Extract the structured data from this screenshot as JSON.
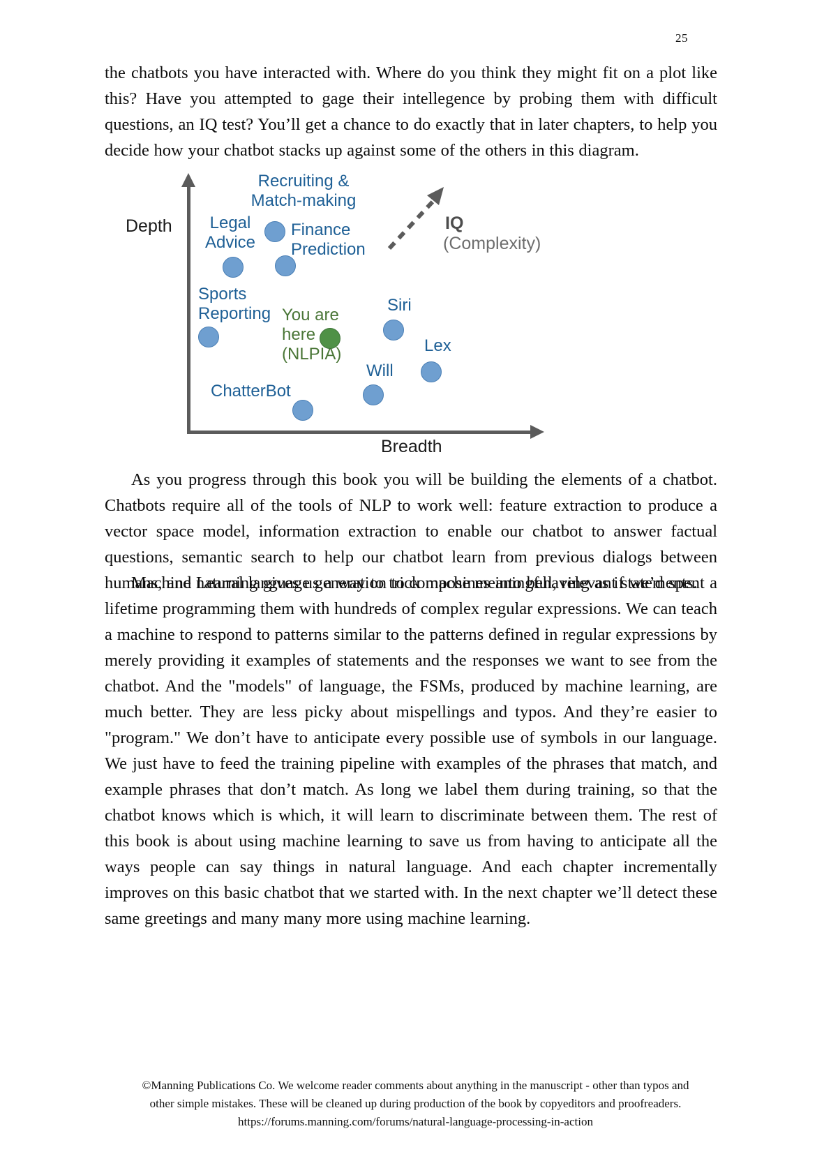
{
  "page": {
    "number": "25"
  },
  "paragraphs": {
    "p1": "the chatbots you have interacted with. Where do you think they might fit on a plot like this? Have you attempted to gage their intellegence by probing them with difficult questions, an IQ test? You’ll get a chance to do exactly that in later chapters, to help you decide how your chatbot stacks up against some of the others in this diagram.",
    "p2": "As you progress through this book you will be building the elements of a chatbot. Chatbots require all of the tools of NLP to work well: feature extraction to produce a vector space model, information extraction to enable our chatbot to answer factual questions, semantic search to help our chatbot learn from previous dialogs between humans, and natural language generation to compose meaningful, relevant statements.",
    "p3": "Machine Learning gives us a way to trick machines into behaving as if we’d spent a lifetime programming them with hundreds of complex regular expressions. We can teach a machine to respond to patterns similar to the patterns defined in regular expressions by merely providing it examples of statements and the responses we want to see from the chatbot. And the \"models\" of language, the FSMs, produced by machine learning, are much better. They are less picky about mispellings and typos. And they’re easier to \"program.\" We don’t have to anticipate every possible use of symbols in our language. We just have to feed the training pipeline with examples of the phrases that match, and example phrases that don’t match. As long we label them during training, so that the chatbot knows which is which, it will learn to discriminate between them. The rest of this book is about using machine learning to save us from having to anticipate all the ways people can say things in natural language. And each chapter incrementally improves on this basic chatbot that we started with. In the next chapter we’ll detect these same greetings and many many more using machine learning."
  },
  "figure": {
    "y_axis_label": "Depth",
    "x_axis_label": "Breadth",
    "annotation": {
      "main": "IQ",
      "sub": "(Complexity)"
    },
    "colors": {
      "dot_blue": "#6f9fd0",
      "dot_green": "#4f9146",
      "label_blue": "#1f6096",
      "label_green": "#4a7637",
      "axis_gray": "#5b5b5b",
      "annotation_gray": "#5b5b5b"
    },
    "points": [
      {
        "label": "Recruiting &\nMatch-making",
        "color": "blue"
      },
      {
        "label": "Legal\nAdvice",
        "color": "blue"
      },
      {
        "label": "Finance\nPrediction",
        "color": "blue"
      },
      {
        "label": "Sports\nReporting",
        "color": "blue"
      },
      {
        "label": "You are\nhere\n(NLPIA)",
        "color": "green"
      },
      {
        "label": "Siri",
        "color": "blue"
      },
      {
        "label": "Lex",
        "color": "blue"
      },
      {
        "label": "Will",
        "color": "blue"
      },
      {
        "label": "ChatterBot",
        "color": "blue"
      }
    ]
  },
  "chart_data": {
    "type": "scatter",
    "title": "",
    "xlabel": "Breadth",
    "ylabel": "Depth",
    "xlim": [
      0,
      100
    ],
    "ylim": [
      0,
      100
    ],
    "grid": false,
    "legend": null,
    "annotations": [
      {
        "text": "IQ (Complexity)",
        "type": "dashed-arrow",
        "direction": "up-right"
      }
    ],
    "points": [
      {
        "name": "Recruiting & Match-making",
        "x": 27,
        "y": 90,
        "color": "#6f9fd0"
      },
      {
        "name": "Legal Advice",
        "x": 15,
        "y": 76,
        "color": "#6f9fd0"
      },
      {
        "name": "Finance Prediction",
        "x": 30,
        "y": 77,
        "color": "#6f9fd0"
      },
      {
        "name": "Sports Reporting",
        "x": 8,
        "y": 48,
        "color": "#6f9fd0"
      },
      {
        "name": "You are here (NLPIA)",
        "x": 44,
        "y": 47,
        "color": "#4f9146"
      },
      {
        "name": "Siri",
        "x": 62,
        "y": 51,
        "color": "#6f9fd0"
      },
      {
        "name": "Lex",
        "x": 73,
        "y": 35,
        "color": "#6f9fd0"
      },
      {
        "name": "Will",
        "x": 56,
        "y": 26,
        "color": "#6f9fd0"
      },
      {
        "name": "ChatterBot",
        "x": 36,
        "y": 20,
        "color": "#6f9fd0"
      }
    ]
  },
  "footer": {
    "line1": "©Manning Publications Co. We welcome reader comments about anything in the manuscript - other than typos and",
    "line2": "other simple mistakes. These will be cleaned up during production of the book by copyeditors and proofreaders.",
    "line3": "https://forums.manning.com/forums/natural-language-processing-in-action"
  }
}
